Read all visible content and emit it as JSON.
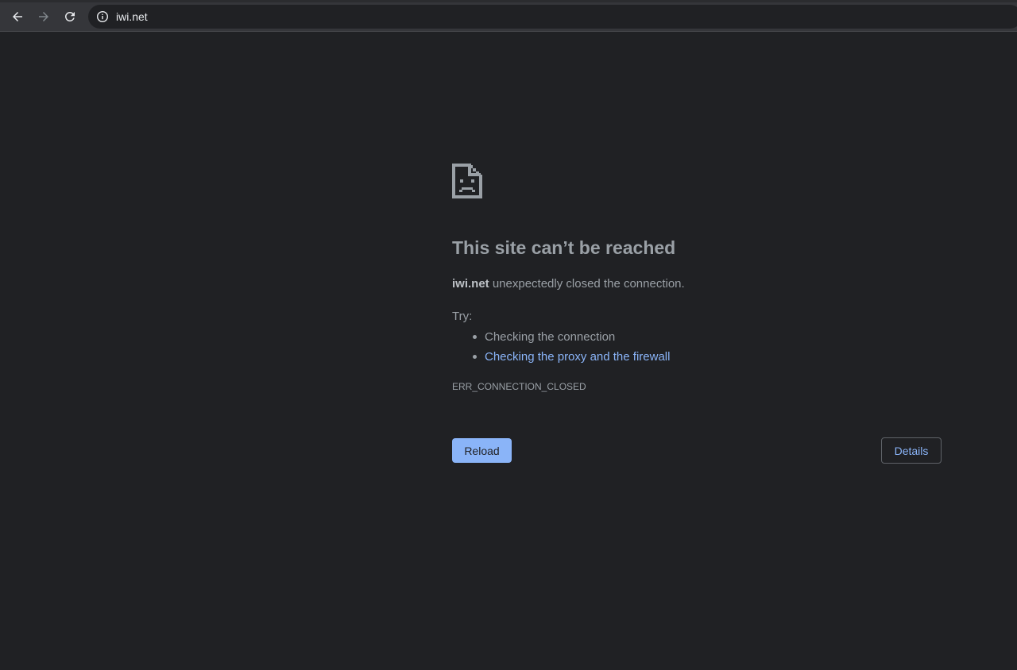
{
  "browser": {
    "url": "iwi.net",
    "icons": {
      "back": "arrow-left-icon",
      "forward": "arrow-right-icon",
      "reload": "reload-icon",
      "site_info": "info-icon"
    }
  },
  "error": {
    "icon": "sad-page-icon",
    "title": "This site can’t be reached",
    "host": "iwi.net",
    "message": " unexpectedly closed the connection.",
    "try_label": "Try:",
    "suggestions": [
      {
        "text": "Checking the connection",
        "is_link": false
      },
      {
        "text": "Checking the proxy and the firewall",
        "is_link": true
      }
    ],
    "code": "ERR_CONNECTION_CLOSED",
    "reload_label": "Reload",
    "details_label": "Details"
  },
  "colors": {
    "background": "#202124",
    "toolbar": "#35363a",
    "text": "#9aa0a6",
    "link": "#8ab4f8",
    "button": "#8ab4f8"
  }
}
